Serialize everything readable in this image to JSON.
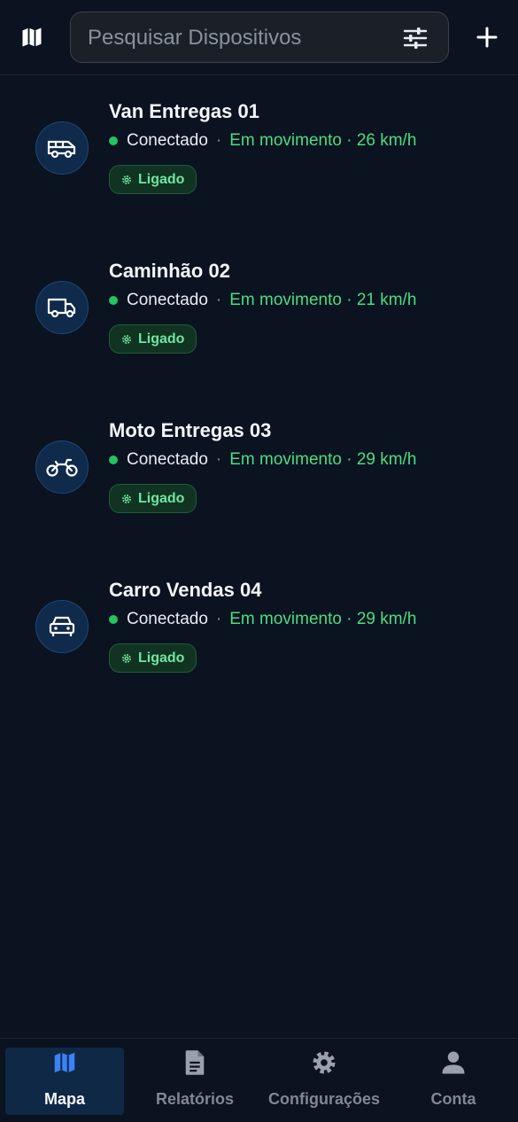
{
  "header": {
    "map_icon": "map-icon",
    "search_placeholder": "Pesquisar Dispositivos",
    "search_value": "",
    "filter_icon": "sliders-icon",
    "add_icon": "plus-icon"
  },
  "devices": [
    {
      "name": "Van Entregas 01",
      "icon": "van-icon",
      "connection": "Conectado",
      "separator": "·",
      "motion": "Em movimento · 26 km/h",
      "ignition": "Ligado"
    },
    {
      "name": "Caminhão 02",
      "icon": "truck-icon",
      "connection": "Conectado",
      "separator": "·",
      "motion": "Em movimento · 21 km/h",
      "ignition": "Ligado"
    },
    {
      "name": "Moto Entregas 03",
      "icon": "motorcycle-icon",
      "connection": "Conectado",
      "separator": "·",
      "motion": "Em movimento · 29 km/h",
      "ignition": "Ligado"
    },
    {
      "name": "Carro Vendas 04",
      "icon": "car-icon",
      "connection": "Conectado",
      "separator": "·",
      "motion": "Em movimento · 29 km/h",
      "ignition": "Ligado"
    }
  ],
  "nav": {
    "items": [
      {
        "label": "Mapa",
        "icon": "map-icon",
        "active": true
      },
      {
        "label": "Relatórios",
        "icon": "document-icon",
        "active": false
      },
      {
        "label": "Configurações",
        "icon": "gear-icon",
        "active": false
      },
      {
        "label": "Conta",
        "icon": "person-icon",
        "active": false
      }
    ]
  },
  "colors": {
    "background": "#0b1220",
    "online": "#22c55e",
    "moving": "#4ade80",
    "active_nav": "#0f2845",
    "accent_blue": "#3b82f6"
  }
}
